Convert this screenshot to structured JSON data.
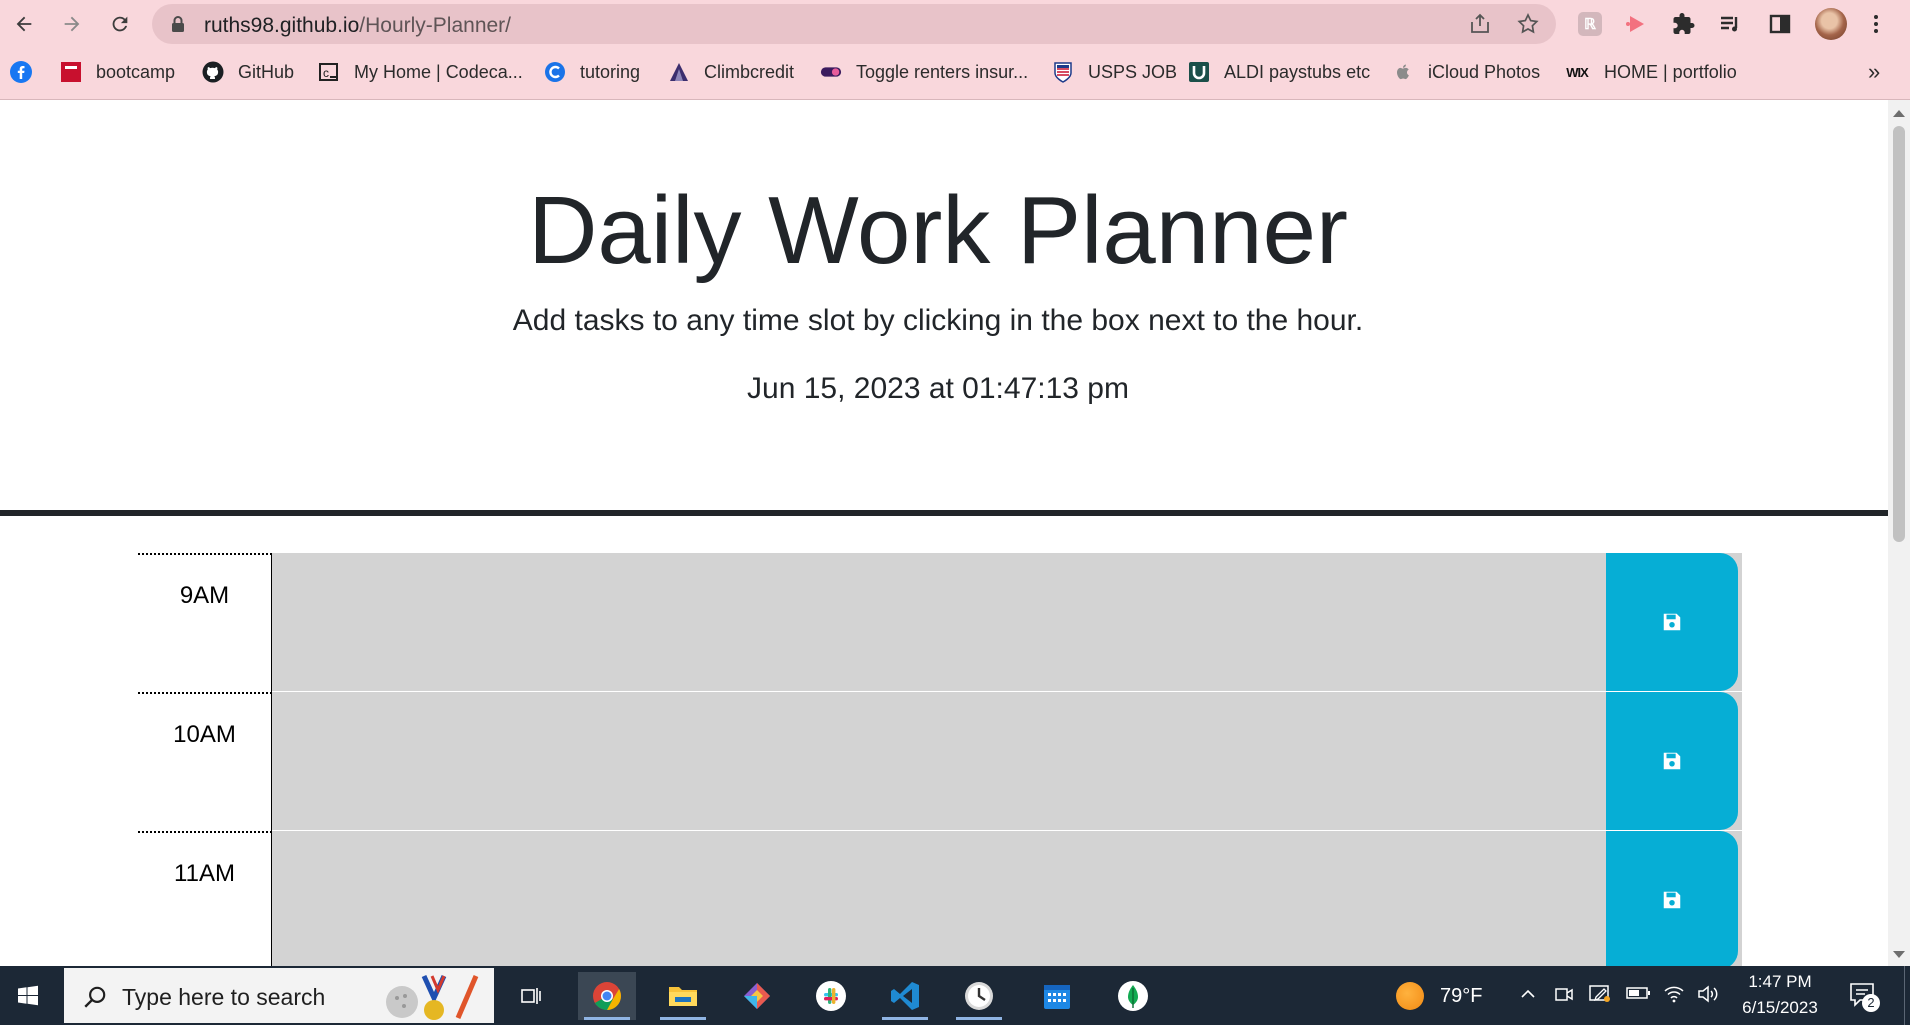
{
  "browser": {
    "url_host": "ruths98.github.io",
    "url_path": "/Hourly-Planner/",
    "bookmarks": [
      {
        "label": "",
        "icon": "facebook-icon"
      },
      {
        "label": "bootcamp",
        "icon": "bootcamp-icon"
      },
      {
        "label": "GitHub",
        "icon": "github-icon"
      },
      {
        "label": "My Home | Codeca...",
        "icon": "codecademy-icon"
      },
      {
        "label": "tutoring",
        "icon": "tutoring-icon"
      },
      {
        "label": "Climbcredit",
        "icon": "climbcredit-icon"
      },
      {
        "label": "Toggle renters insur...",
        "icon": "toggle-icon"
      },
      {
        "label": "USPS JOB",
        "icon": "usps-icon"
      },
      {
        "label": "ALDI paystubs etc",
        "icon": "aldi-icon"
      },
      {
        "label": "iCloud Photos",
        "icon": "apple-icon"
      },
      {
        "label": "HOME | portfolio",
        "icon": "wix-icon"
      }
    ],
    "bookmark_overflow": "»",
    "wix_label": "WIX"
  },
  "header": {
    "title": "Daily Work Planner",
    "lead": "Add tasks to any time slot by clicking in the box next to the hour.",
    "current_datetime": "Jun 15, 2023 at 01:47:13 pm"
  },
  "planner": {
    "rows": [
      {
        "hour": "9AM",
        "task": ""
      },
      {
        "hour": "10AM",
        "task": ""
      },
      {
        "hour": "11AM",
        "task": ""
      }
    ],
    "save_icon": "floppy-disk-icon",
    "colors": {
      "save_button": "#06aed5",
      "past_slot": "#d3d3d3"
    }
  },
  "taskbar": {
    "search_placeholder": "Type here to search",
    "weather": "79°F",
    "time": "1:47 PM",
    "date": "6/15/2023",
    "notification_count": "2"
  }
}
